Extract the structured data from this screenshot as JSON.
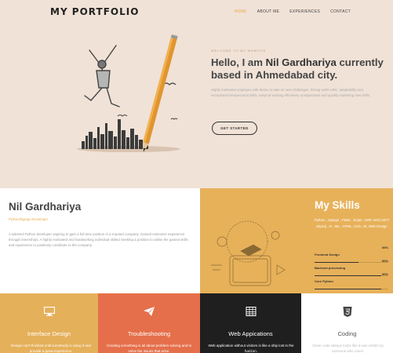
{
  "brand": "MY PORTFOLIO",
  "nav": [
    {
      "label": "HOME",
      "active": true
    },
    {
      "label": "ABOUT ME",
      "active": false
    },
    {
      "label": "EXPERIENCES",
      "active": false
    },
    {
      "label": "CONTACT",
      "active": false
    }
  ],
  "hero": {
    "tagline": "WELCOME TO MY WEBSITE",
    "greeting": "Hello, I am ",
    "name": "Nil Gardhariya",
    "greeting_rest": " currently based in Ahmedabad city.",
    "description": "Highly motivated employee with desire to take on new challenges. Strong worth ethic, adaptability and exceptional interpersonal skills. Adept at working effectively unsupervised and quickly mastering new skills.",
    "button": "GET STARTED"
  },
  "about": {
    "name": "Nil Gardhariya",
    "role": "Python/Django Developer",
    "text": "A talented Python developer aspiring to gain a full time position in a reputed company. Gained extensive experience through internships. A highly motivated and hardworking individual skilled Seeking a position to utilise the gained skills and experience to positively contribute to the company."
  },
  "skills": {
    "title": "My Skills",
    "list": "Python , Django , Flask , Jinja2 , DRF, MVC,MVT , MySql , AI , ML , HTML, CSS, JS, Web Design",
    "items": [
      {
        "label": "Frontend Design",
        "percent": "60%",
        "value": 0.6
      },
      {
        "label": "Backend processing",
        "percent": "90%",
        "value": 0.9
      },
      {
        "label": "Core Python",
        "percent": "90%",
        "value": 0.9
      }
    ]
  },
  "services": [
    {
      "icon": "monitor-icon",
      "title": "Interface Design",
      "desc": "Design can't finished until somebody is using it and provide a great experience."
    },
    {
      "icon": "paper-plane-icon",
      "title": "Troubleshooting",
      "desc": "Creating something is all about problem solving and to solve the issues that arise."
    },
    {
      "icon": "table-icon",
      "title": "Web Appications",
      "desc": "Web application without visitors is like a ship lost in the horizon."
    },
    {
      "icon": "html5-icon",
      "title": "Coding",
      "desc": "Clean code always looks like it was written by someone who cares."
    }
  ]
}
